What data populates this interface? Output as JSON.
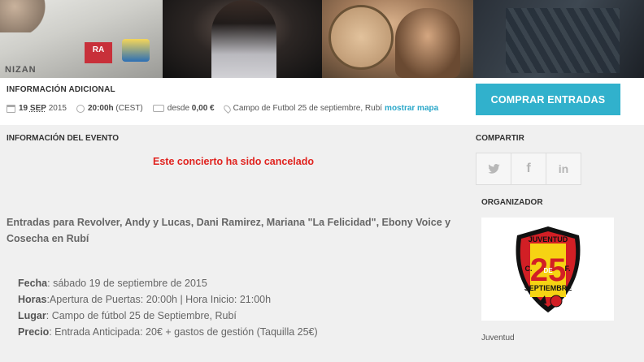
{
  "banner": {
    "panel1_text": "NIZAN",
    "panel1_logo": "RA"
  },
  "info": {
    "title": "INFORMACIÓN ADICIONAL",
    "date_day": "19",
    "date_month": "SEP",
    "date_year": "2015",
    "time": "20:00h",
    "timezone": "(CEST)",
    "price_prefix": "desde",
    "price": "0,00 €",
    "location": "Campo de Futbol 25 de septiembre, Rubí",
    "map_link": "mostrar mapa",
    "buy_button": "COMPRAR ENTRADAS"
  },
  "event": {
    "section_title": "INFORMACIÓN DEL EVENTO",
    "cancelled_notice": "Este concierto ha sido cancelado",
    "headline": "Entradas para Revolver, Andy y Lucas, Dani Ramirez, Mariana \"La Felicidad\", Ebony Voice y Cosecha en Rubí",
    "details": [
      {
        "key": "Fecha",
        "sep": ": ",
        "value": "sábado 19 de septiembre de 2015"
      },
      {
        "key": "Horas",
        "sep": ":",
        "value": "Apertura de Puertas: 20:00h | Hora Inicio: 21:00h"
      },
      {
        "key": "Lugar",
        "sep": ": ",
        "value": "Campo de fútbol 25 de Septiembre, Rubí"
      },
      {
        "key": "Precio",
        "sep": ": ",
        "value": "Entrada Anticipada: 20€ + gastos de gestión (Taquilla 25€)"
      }
    ]
  },
  "sidebar": {
    "share_title": "COMPARTIR",
    "share_buttons": [
      {
        "icon": "twitter-icon",
        "glyph": "🐦"
      },
      {
        "icon": "facebook-icon",
        "glyph": "f"
      },
      {
        "icon": "linkedin-icon",
        "glyph": "in"
      }
    ],
    "organizer_title": "ORGANIZADOR",
    "organizer_logo": {
      "top": "JUVENTUD",
      "number": "25",
      "left": "C.",
      "middle": "DE",
      "right": "F.",
      "bottom": "SEPTIEMBRE",
      "colors": {
        "red": "#d21f25",
        "yellow": "#f6d313",
        "black": "#111111"
      }
    },
    "organizer_name": "Juventud"
  },
  "colors": {
    "accent": "#31b1cc",
    "cancel_red": "#e0231f"
  }
}
